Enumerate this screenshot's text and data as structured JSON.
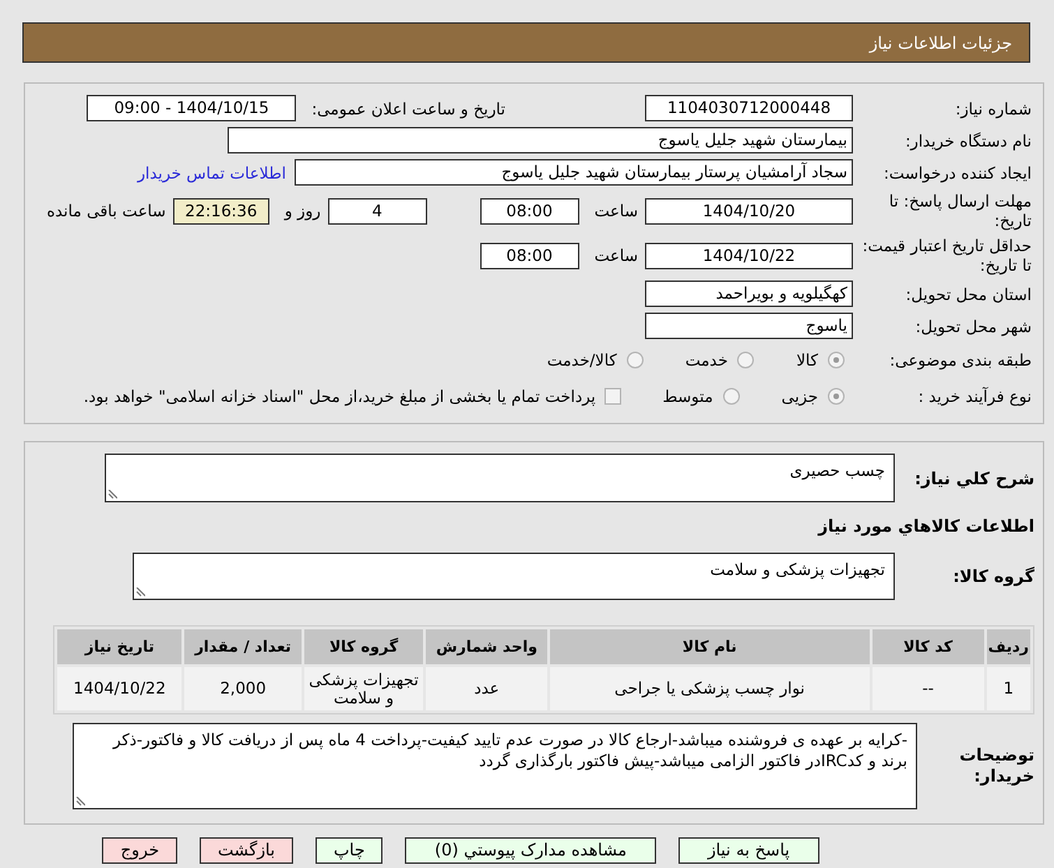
{
  "header": {
    "title": "جزئیات اطلاعات نیاز"
  },
  "need_number": {
    "label": "شماره نیاز:",
    "value": "1104030712000448"
  },
  "announce": {
    "label": "تاریخ و ساعت اعلان عمومی:",
    "value": "1404/10/15 - 09:00"
  },
  "buyer": {
    "label": "نام دستگاه خریدار:",
    "value": "بیمارستان شهید جلیل یاسوج"
  },
  "creator": {
    "label": "ایجاد کننده درخواست:",
    "value": "سجاد آرامشیان پرستار بیمارستان شهید جلیل یاسوج",
    "contact_link": "اطلاعات تماس خریدار"
  },
  "reply_deadline": {
    "label": "مهلت ارسال پاسخ: تا تاریخ:",
    "date": "1404/10/20",
    "time_label": "ساعت",
    "time": "08:00",
    "days": "4",
    "days_label": "روز و",
    "remaining": "22:16:36",
    "remaining_label": "ساعت باقی مانده"
  },
  "price_validity": {
    "label": "حداقل تاریخ اعتبار قیمت: تا تاریخ:",
    "date": "1404/10/22",
    "time_label": "ساعت",
    "time": "08:00"
  },
  "province": {
    "label": "استان محل تحویل:",
    "value": "کهگیلویه و بویراحمد"
  },
  "city": {
    "label": "شهر محل تحویل:",
    "value": "یاسوج"
  },
  "category": {
    "label": "طبقه بندی موضوعی:",
    "options": [
      {
        "label": "کالا",
        "selected": true
      },
      {
        "label": "خدمت",
        "selected": false
      },
      {
        "label": "کالا/خدمت",
        "selected": false
      }
    ]
  },
  "purchase_type": {
    "label": "نوع فرآیند خرید :",
    "options": [
      {
        "label": "جزیی",
        "selected": true
      },
      {
        "label": "متوسط",
        "selected": false
      }
    ],
    "payment_option": {
      "label": "پرداخت تمام یا بخشی از مبلغ خرید،از محل \"اسناد خزانه اسلامی\" خواهد بود.",
      "checked": false
    }
  },
  "description": {
    "label": "شرح کلي نیاز:",
    "value": "چسب حصیری"
  },
  "goods_heading": "اطلاعات کالاهاي مورد نیاز",
  "goods_group": {
    "label": "گروه کالا:",
    "value": "تجهیزات پزشکی و سلامت"
  },
  "table": {
    "columns": [
      "ردیف",
      "کد کالا",
      "نام کالا",
      "واحد شمارش",
      "گروه کالا",
      "تعداد / مقدار",
      "تاریخ نیاز"
    ],
    "rows": [
      [
        "1",
        "--",
        "نوار چسب پزشکی یا جراحی",
        "عدد",
        "تجهیزات پزشکی و سلامت",
        "2,000",
        "1404/10/22"
      ]
    ]
  },
  "buyer_notes": {
    "label": "توضیحات خریدار:",
    "value": "-کرایه بر عهده ی فروشنده میباشد-ارجاع کالا در صورت عدم تایید کیفیت-پرداخت 4 ماه پس از دریافت کالا و فاکتور-ذکر برند و کدIRCدر فاکتور الزامی میباشد-پیش فاکتور بارگذاری گردد"
  },
  "buttons": [
    {
      "label": "پاسخ به نیاز",
      "kind": "normal"
    },
    {
      "label": "مشاهده مدارک پیوستي (0)",
      "kind": "normal"
    },
    {
      "label": "چاپ",
      "kind": "normal"
    },
    {
      "label": "بازگشت",
      "kind": "danger"
    },
    {
      "label": "خروج",
      "kind": "danger"
    }
  ]
}
